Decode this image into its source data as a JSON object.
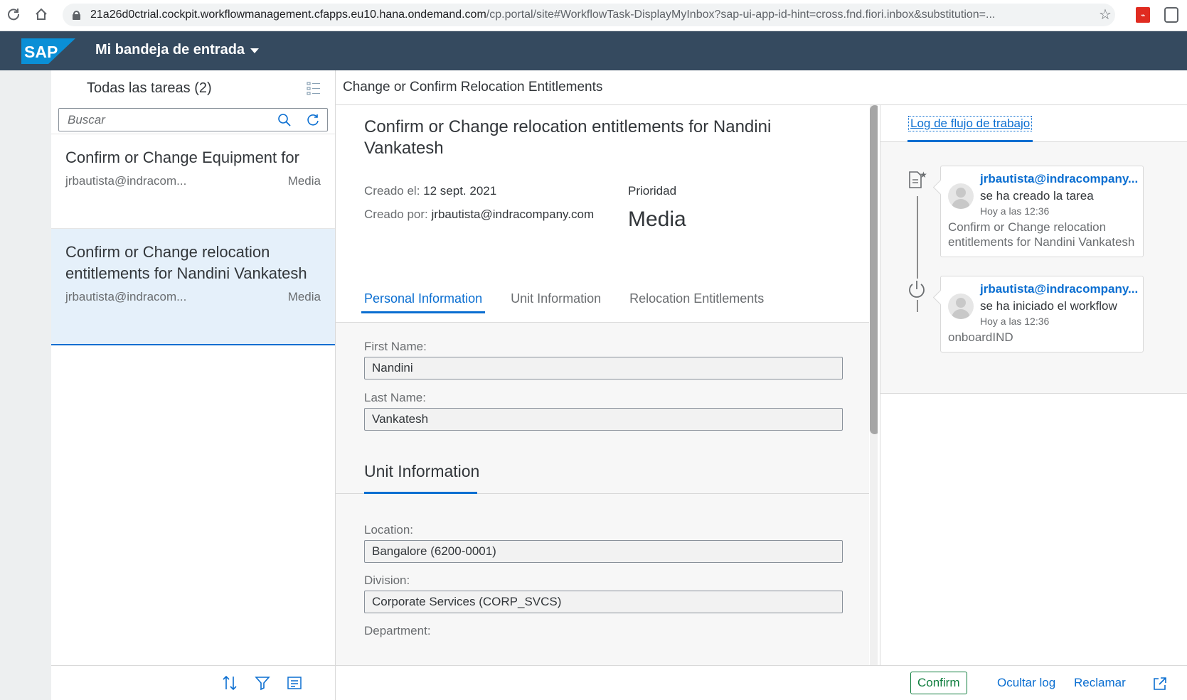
{
  "browser": {
    "url_host": "21a26d0ctrial.cockpit.workflowmanagement.cfapps.eu10.hana.ondemand.com",
    "url_path": "/cp.portal/site#WorkflowTask-DisplayMyInbox?sap-ui-app-id-hint=cross.fnd.fiori.inbox&substitution=..."
  },
  "shell": {
    "logo": "SAP",
    "title": "Mi bandeja de entrada"
  },
  "master": {
    "header": "Todas las tareas (2)",
    "search_placeholder": "Buscar",
    "items": [
      {
        "title": "Confirm or Change Equipment for",
        "sender": "jrbautista@indracom...",
        "priority": "Media"
      },
      {
        "title": "Confirm or Change relocation entitlements for Nandini Vankatesh",
        "sender": "jrbautista@indracom...",
        "priority": "Media"
      }
    ]
  },
  "detail": {
    "header": "Change or Confirm Relocation Entitlements",
    "title": "Confirm or Change relocation entitlements for Nandini Vankatesh",
    "created_on_label": "Creado el:",
    "created_on": "12 sept. 2021",
    "created_by_label": "Creado por:",
    "created_by": "jrbautista@indracompany.com",
    "priority_label": "Prioridad",
    "priority_value": "Media",
    "tabs": [
      "Personal Information",
      "Unit Information",
      "Relocation Entitlements"
    ],
    "form": {
      "first_name_label": "First Name:",
      "first_name": "Nandini",
      "last_name_label": "Last Name:",
      "last_name": "Vankatesh",
      "unit_section": "Unit Information",
      "location_label": "Location:",
      "location": "Bangalore (6200-0001)",
      "division_label": "Division:",
      "division": "Corporate Services (CORP_SVCS)",
      "department_label": "Department:"
    }
  },
  "log": {
    "tab": "Log de flujo de trabajo",
    "entries": [
      {
        "user": "jrbautista@indracompany...",
        "action": "se ha creado la tarea",
        "time": "Hoy a las 12:36",
        "text": "Confirm or Change relocation entitlements for Nandini Vankatesh"
      },
      {
        "user": "jrbautista@indracompany...",
        "action": "se ha iniciado el workflow",
        "time": "Hoy a las 12:36",
        "text": "onboardIND"
      }
    ]
  },
  "footer": {
    "confirm": "Confirm",
    "hide_log": "Ocultar log",
    "claim": "Reclamar"
  },
  "colors": {
    "shell": "#354a5f",
    "accent": "#0a6ed1",
    "positive": "#107e3e",
    "selected_row": "#e5f0fa"
  }
}
